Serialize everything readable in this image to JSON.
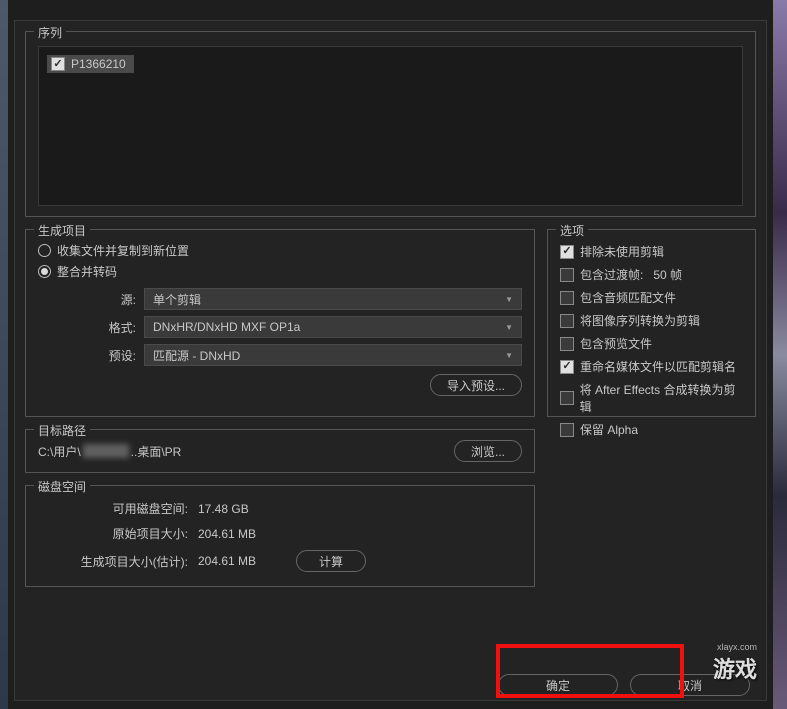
{
  "sequence": {
    "legend": "序列",
    "items": [
      {
        "label": "P1366210",
        "checked": true
      }
    ]
  },
  "generate": {
    "legend": "生成项目",
    "radio_collect": "收集文件并复制到新位置",
    "radio_consolidate": "整合并转码",
    "source_label": "源:",
    "source_value": "单个剪辑",
    "format_label": "格式:",
    "format_value": "DNxHR/DNxHD MXF OP1a",
    "preset_label": "预设:",
    "preset_value": "匹配源 - DNxHD",
    "import_preset_btn": "导入预设..."
  },
  "options": {
    "legend": "选项",
    "items": [
      {
        "label": "排除未使用剪辑",
        "checked": true
      },
      {
        "label": "包含过渡帧:",
        "checked": false,
        "extra": "50 帧"
      },
      {
        "label": "包含音频匹配文件",
        "checked": false
      },
      {
        "label": "将图像序列转换为剪辑",
        "checked": false
      },
      {
        "label": "包含预览文件",
        "checked": false
      },
      {
        "label": "重命名媒体文件以匹配剪辑名",
        "checked": true
      },
      {
        "label": "将 After Effects 合成转换为剪辑",
        "checked": false
      },
      {
        "label": "保留 Alpha",
        "checked": false
      }
    ]
  },
  "dest": {
    "legend": "目标路径",
    "path_prefix": "C:\\用户\\",
    "path_suffix": "..桌面\\PR",
    "browse_btn": "浏览..."
  },
  "disk": {
    "legend": "磁盘空间",
    "available_label": "可用磁盘空间:",
    "available_value": "17.48 GB",
    "original_label": "原始项目大小:",
    "original_value": "204.61 MB",
    "estimated_label": "生成项目大小(估计):",
    "estimated_value": "204.61 MB",
    "calc_btn": "计算"
  },
  "footer": {
    "ok": "确定",
    "cancel": "取消"
  },
  "watermark": {
    "site": "xlayx.com",
    "main": "游戏"
  }
}
